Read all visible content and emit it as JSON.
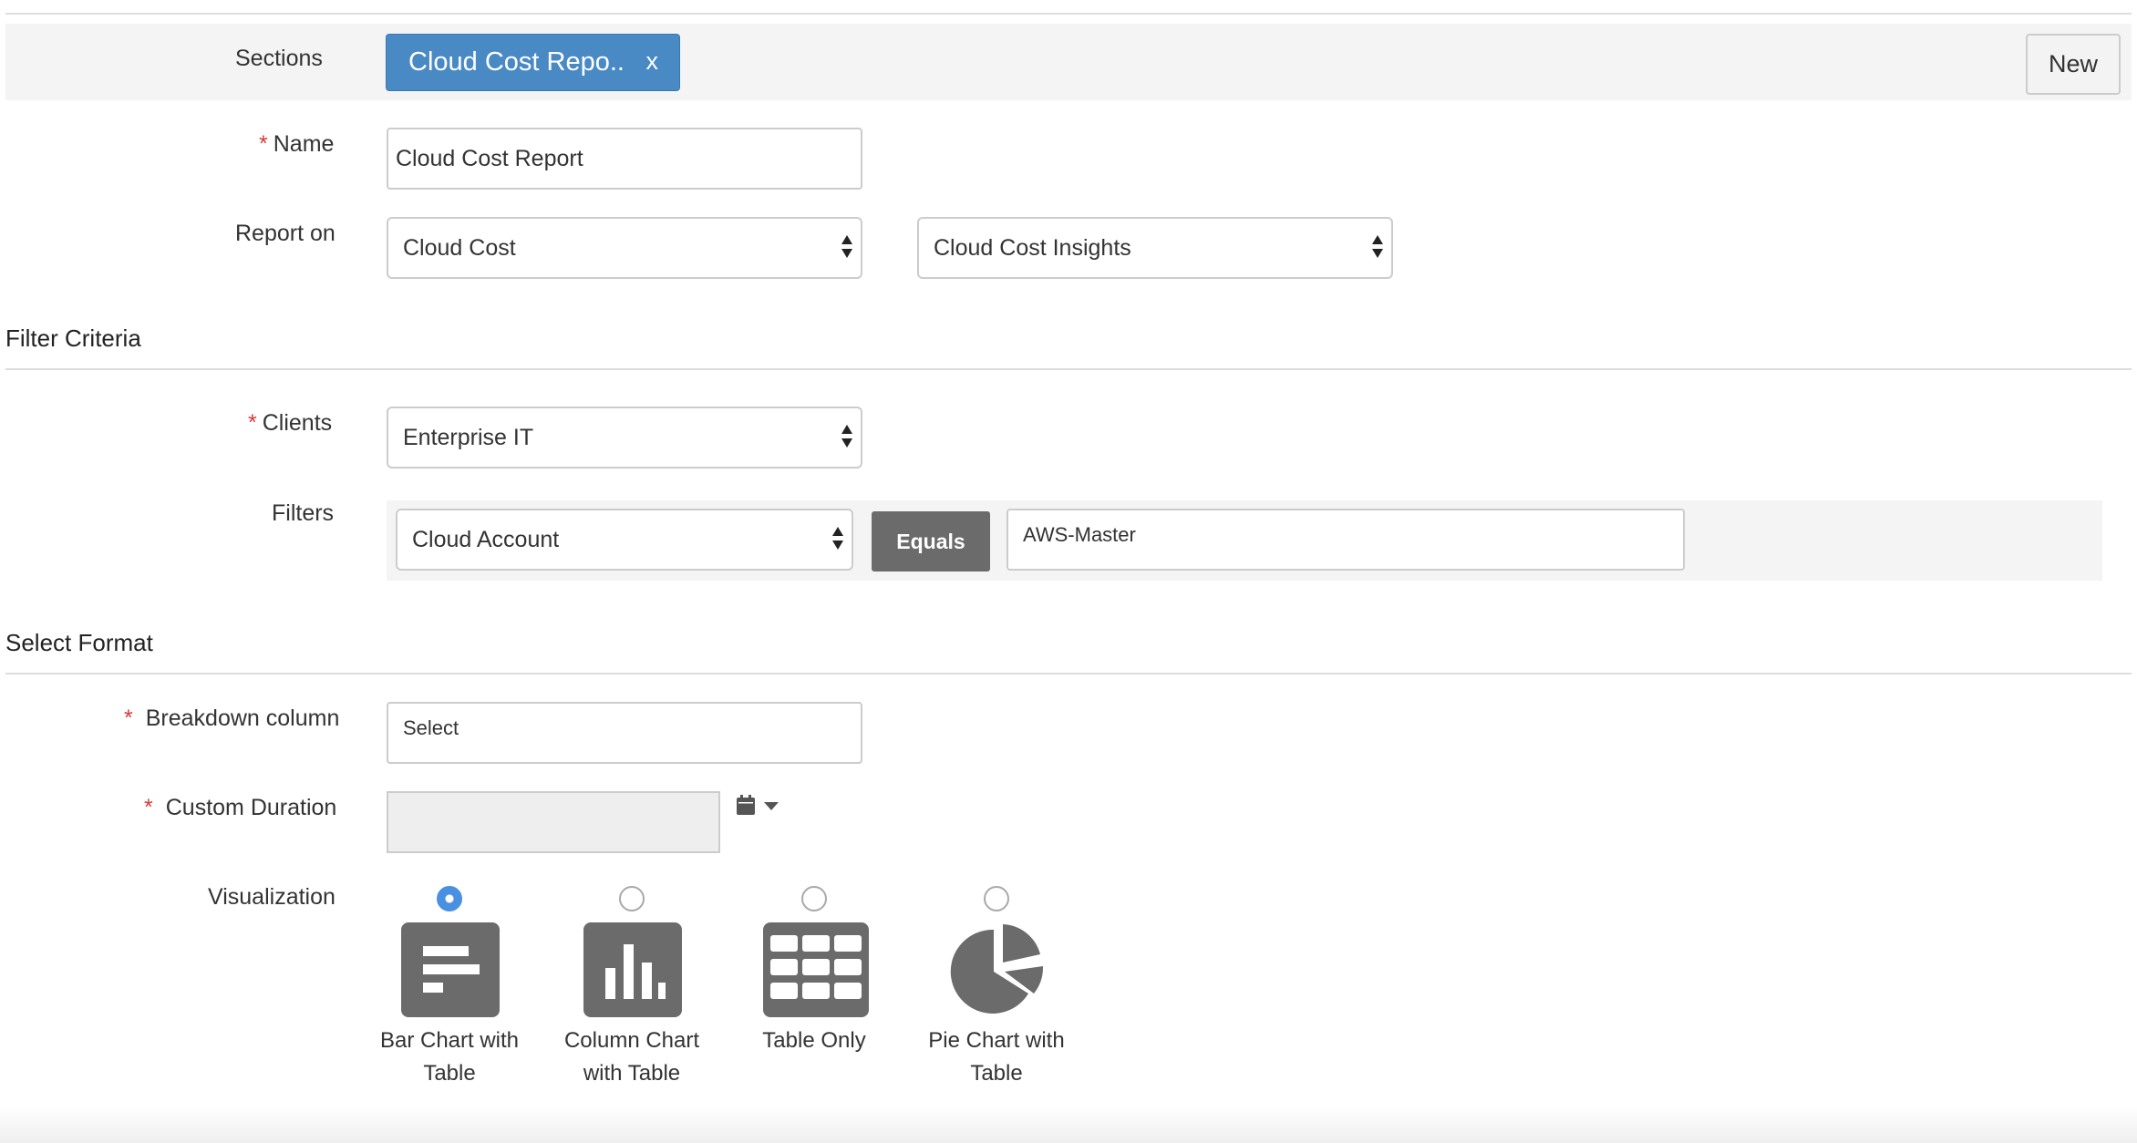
{
  "sections": {
    "label": "Sections",
    "tag_label": "Cloud Cost Repo..",
    "tag_close": "x",
    "new_button": "New"
  },
  "form": {
    "name_label": "Name",
    "name_value": "Cloud Cost Report",
    "report_on_label": "Report on",
    "report_on_value": "Cloud Cost",
    "report_type_value": "Cloud Cost Insights",
    "required_mark": "*"
  },
  "filter_criteria": {
    "heading": "Filter Criteria",
    "clients_label": "Clients",
    "clients_value": "Enterprise IT",
    "filters_label": "Filters",
    "filter_field_value": "Cloud Account",
    "operator_button": "Equals",
    "filter_value": "AWS-Master"
  },
  "select_format": {
    "heading": "Select Format",
    "breakdown_label": "Breakdown column",
    "breakdown_value": "Select",
    "duration_label": "Custom Duration",
    "visualization_label": "Visualization",
    "options": [
      {
        "line1": "Bar Chart with",
        "line2": "Table",
        "icon": "bar-chart-icon",
        "checked": true
      },
      {
        "line1": "Column Chart",
        "line2": "with Table",
        "icon": "column-chart-icon",
        "checked": false
      },
      {
        "line1": "Table Only",
        "line2": "",
        "icon": "table-icon",
        "checked": false
      },
      {
        "line1": "Pie Chart with",
        "line2": "Table",
        "icon": "pie-chart-icon",
        "checked": false
      }
    ]
  },
  "colors": {
    "tag_blue": "#4a8ac4",
    "required_red": "#d9383a",
    "icon_gray": "#6b6b6b",
    "radio_checked": "#4a90e2"
  }
}
